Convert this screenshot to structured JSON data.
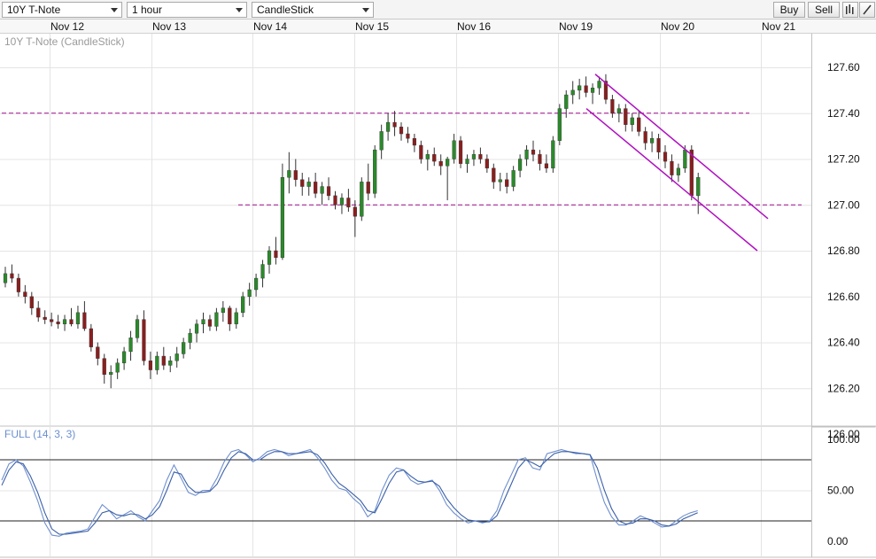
{
  "toolbar": {
    "symbol": "10Y T-Note",
    "interval": "1 hour",
    "chart_type": "CandleStick",
    "buy_label": "Buy",
    "sell_label": "Sell",
    "bars_icon": "bars-icon",
    "draw_icon": "pencil-icon"
  },
  "chart_data": [
    {
      "type": "candlestick",
      "title": "10Y T-Note (CandleStick)",
      "x_categories": [
        "Nov 12",
        "Nov 13",
        "Nov 14",
        "Nov 15",
        "Nov 16",
        "Nov 19",
        "Nov 20",
        "Nov 21"
      ],
      "ylim": [
        126.0,
        127.7
      ],
      "y_ticks": [
        "127.60",
        "127.40",
        "127.20",
        "127.00",
        "126.80",
        "126.60",
        "126.40",
        "126.20",
        "126.00"
      ],
      "grid": true,
      "colors": {
        "up": "#2a8a2a",
        "down": "#8b1e1e",
        "wick": "#333333",
        "levels": "#a0108f",
        "channel": "#b010c0"
      },
      "horizontal_levels": [
        {
          "value": 127.4,
          "from": "Nov 12",
          "to": "Nov 20"
        },
        {
          "value": 127.0,
          "from": "Nov 14",
          "to": "Nov 21"
        }
      ],
      "channel": {
        "upper": {
          "start": [
            "Nov 19",
            127.57
          ],
          "end": [
            "Nov 21",
            126.94
          ]
        },
        "lower": {
          "start": [
            "Nov 19",
            127.42
          ],
          "end": [
            "Nov 21",
            126.8
          ]
        }
      },
      "ohlc": [
        [
          126.66,
          126.73,
          126.64,
          126.7
        ],
        [
          126.7,
          126.74,
          126.66,
          126.68
        ],
        [
          126.68,
          126.7,
          126.6,
          126.62
        ],
        [
          126.62,
          126.65,
          126.57,
          126.6
        ],
        [
          126.6,
          126.62,
          126.52,
          126.55
        ],
        [
          126.55,
          126.58,
          126.49,
          126.51
        ],
        [
          126.51,
          126.54,
          126.48,
          126.5
        ],
        [
          126.5,
          126.53,
          126.47,
          126.49
        ],
        [
          126.49,
          126.52,
          126.46,
          126.48
        ],
        [
          126.48,
          126.52,
          126.45,
          126.5
        ],
        [
          126.5,
          126.55,
          126.47,
          126.48
        ],
        [
          126.48,
          126.56,
          126.46,
          126.53
        ],
        [
          126.53,
          126.58,
          126.45,
          126.46
        ],
        [
          126.46,
          126.48,
          126.36,
          126.38
        ],
        [
          126.38,
          126.4,
          126.3,
          126.33
        ],
        [
          126.33,
          126.35,
          126.22,
          126.26
        ],
        [
          126.26,
          126.3,
          126.2,
          126.27
        ],
        [
          126.27,
          126.33,
          126.24,
          126.31
        ],
        [
          126.31,
          126.38,
          126.28,
          126.36
        ],
        [
          126.36,
          126.45,
          126.32,
          126.42
        ],
        [
          126.42,
          126.52,
          126.4,
          126.5
        ],
        [
          126.5,
          126.54,
          126.3,
          126.32
        ],
        [
          126.32,
          126.36,
          126.24,
          126.28
        ],
        [
          126.28,
          126.36,
          126.26,
          126.34
        ],
        [
          126.34,
          126.38,
          126.28,
          126.3
        ],
        [
          126.3,
          126.34,
          126.27,
          126.32
        ],
        [
          126.32,
          126.38,
          126.29,
          126.35
        ],
        [
          126.35,
          126.42,
          126.33,
          126.4
        ],
        [
          126.4,
          126.46,
          126.37,
          126.44
        ],
        [
          126.44,
          126.5,
          126.4,
          126.48
        ],
        [
          126.48,
          126.53,
          126.44,
          126.5
        ],
        [
          126.5,
          126.52,
          126.45,
          126.47
        ],
        [
          126.47,
          126.55,
          126.45,
          126.53
        ],
        [
          126.53,
          126.58,
          126.49,
          126.55
        ],
        [
          126.55,
          126.56,
          126.45,
          126.48
        ],
        [
          126.48,
          126.55,
          126.46,
          126.53
        ],
        [
          126.53,
          126.62,
          126.51,
          126.6
        ],
        [
          126.6,
          126.66,
          126.56,
          126.63
        ],
        [
          126.63,
          126.7,
          126.6,
          126.68
        ],
        [
          126.68,
          126.76,
          126.64,
          126.74
        ],
        [
          126.74,
          126.82,
          126.7,
          126.8
        ],
        [
          126.8,
          126.86,
          126.74,
          126.77
        ],
        [
          126.77,
          127.18,
          126.76,
          127.12
        ],
        [
          127.12,
          127.23,
          127.05,
          127.15
        ],
        [
          127.15,
          127.2,
          127.08,
          127.11
        ],
        [
          127.11,
          127.14,
          127.04,
          127.08
        ],
        [
          127.08,
          127.12,
          127.04,
          127.1
        ],
        [
          127.1,
          127.14,
          127.03,
          127.05
        ],
        [
          127.05,
          127.1,
          127.0,
          127.08
        ],
        [
          127.08,
          127.12,
          127.02,
          127.04
        ],
        [
          127.04,
          127.06,
          126.98,
          127.0
        ],
        [
          127.0,
          127.05,
          126.96,
          127.03
        ],
        [
          127.03,
          127.07,
          126.97,
          126.99
        ],
        [
          126.99,
          127.02,
          126.86,
          126.95
        ],
        [
          126.95,
          127.12,
          126.93,
          127.1
        ],
        [
          127.1,
          127.18,
          127.02,
          127.05
        ],
        [
          127.05,
          127.26,
          127.03,
          127.24
        ],
        [
          127.24,
          127.35,
          127.2,
          127.32
        ],
        [
          127.32,
          127.4,
          127.28,
          127.36
        ],
        [
          127.36,
          127.41,
          127.3,
          127.34
        ],
        [
          127.34,
          127.36,
          127.28,
          127.31
        ],
        [
          127.31,
          127.34,
          127.27,
          127.29
        ],
        [
          127.29,
          127.31,
          127.23,
          127.26
        ],
        [
          127.26,
          127.28,
          127.18,
          127.2
        ],
        [
          127.2,
          127.24,
          127.15,
          127.22
        ],
        [
          127.22,
          127.25,
          127.17,
          127.19
        ],
        [
          127.19,
          127.22,
          127.13,
          127.17
        ],
        [
          127.17,
          127.21,
          127.02,
          127.2
        ],
        [
          127.2,
          127.31,
          127.18,
          127.28
        ],
        [
          127.28,
          127.3,
          127.16,
          127.18
        ],
        [
          127.18,
          127.22,
          127.14,
          127.2
        ],
        [
          127.2,
          127.24,
          127.17,
          127.22
        ],
        [
          127.22,
          127.25,
          127.18,
          127.2
        ],
        [
          127.2,
          127.22,
          127.14,
          127.16
        ],
        [
          127.16,
          127.18,
          127.07,
          127.1
        ],
        [
          127.1,
          127.14,
          127.06,
          127.11
        ],
        [
          127.11,
          127.14,
          127.05,
          127.08
        ],
        [
          127.08,
          127.17,
          127.06,
          127.15
        ],
        [
          127.15,
          127.22,
          127.12,
          127.2
        ],
        [
          127.2,
          127.26,
          127.17,
          127.24
        ],
        [
          127.24,
          127.28,
          127.19,
          127.22
        ],
        [
          127.22,
          127.24,
          127.15,
          127.18
        ],
        [
          127.18,
          127.22,
          127.14,
          127.16
        ],
        [
          127.16,
          127.3,
          127.14,
          127.28
        ],
        [
          127.28,
          127.44,
          127.26,
          127.42
        ],
        [
          127.42,
          127.5,
          127.38,
          127.48
        ],
        [
          127.48,
          127.54,
          127.44,
          127.5
        ],
        [
          127.5,
          127.55,
          127.46,
          127.52
        ],
        [
          127.52,
          127.56,
          127.47,
          127.49
        ],
        [
          127.49,
          127.53,
          127.44,
          127.51
        ],
        [
          127.51,
          127.56,
          127.48,
          127.54
        ],
        [
          127.54,
          127.57,
          127.44,
          127.46
        ],
        [
          127.46,
          127.48,
          127.38,
          127.4
        ],
        [
          127.4,
          127.44,
          127.36,
          127.42
        ],
        [
          127.42,
          127.44,
          127.32,
          127.35
        ],
        [
          127.35,
          127.4,
          127.32,
          127.38
        ],
        [
          127.38,
          127.41,
          127.3,
          127.32
        ],
        [
          127.32,
          127.34,
          127.24,
          127.27
        ],
        [
          127.27,
          127.32,
          127.23,
          127.29
        ],
        [
          127.29,
          127.31,
          127.2,
          127.23
        ],
        [
          127.23,
          127.26,
          127.16,
          127.19
        ],
        [
          127.19,
          127.22,
          127.1,
          127.13
        ],
        [
          127.13,
          127.18,
          127.1,
          127.16
        ],
        [
          127.16,
          127.26,
          127.14,
          127.24
        ],
        [
          127.24,
          127.26,
          127.02,
          127.04
        ],
        [
          127.04,
          127.14,
          126.96,
          127.12
        ]
      ]
    },
    {
      "type": "line",
      "title": "FULL (14, 3, 3)",
      "ylim": [
        0,
        100
      ],
      "y_ticks": [
        "100.00",
        "50.00",
        "0.00"
      ],
      "reference_lines": [
        80,
        20
      ],
      "colors": {
        "k": "#6f8fcf",
        "d": "#3a5fa8",
        "ref": "#222222"
      },
      "series": [
        {
          "values": [
            60,
            76,
            80,
            74,
            58,
            40,
            18,
            6,
            5,
            8,
            9,
            10,
            12,
            24,
            36,
            30,
            22,
            26,
            30,
            24,
            20,
            30,
            40,
            60,
            75,
            62,
            48,
            45,
            50,
            50,
            62,
            78,
            88,
            90,
            85,
            78,
            82,
            88,
            90,
            88,
            84,
            86,
            88,
            90,
            82,
            72,
            60,
            52,
            50,
            42,
            36,
            24,
            30,
            50,
            65,
            72,
            70,
            60,
            56,
            58,
            60,
            50,
            36,
            28,
            22,
            18,
            20,
            18,
            20,
            30,
            50,
            65,
            80,
            82,
            72,
            70,
            86,
            88,
            90,
            88,
            86,
            86,
            85,
            60,
            38,
            24,
            16,
            16,
            20,
            25,
            22,
            18,
            14,
            15,
            20,
            25,
            28,
            30
          ]
        },
        {
          "values": [
            55,
            70,
            78,
            76,
            64,
            48,
            28,
            12,
            7,
            7,
            8,
            9,
            10,
            18,
            28,
            30,
            26,
            25,
            27,
            26,
            22,
            26,
            34,
            50,
            68,
            66,
            54,
            48,
            48,
            49,
            56,
            70,
            82,
            88,
            86,
            80,
            80,
            85,
            88,
            88,
            86,
            86,
            87,
            88,
            85,
            77,
            66,
            57,
            52,
            46,
            40,
            30,
            28,
            42,
            57,
            68,
            70,
            64,
            59,
            58,
            59,
            54,
            42,
            33,
            26,
            21,
            20,
            19,
            19,
            25,
            40,
            56,
            72,
            80,
            77,
            73,
            80,
            86,
            88,
            88,
            87,
            86,
            85,
            72,
            50,
            32,
            20,
            17,
            18,
            22,
            22,
            20,
            16,
            15,
            17,
            22,
            25,
            28
          ]
        }
      ]
    }
  ]
}
